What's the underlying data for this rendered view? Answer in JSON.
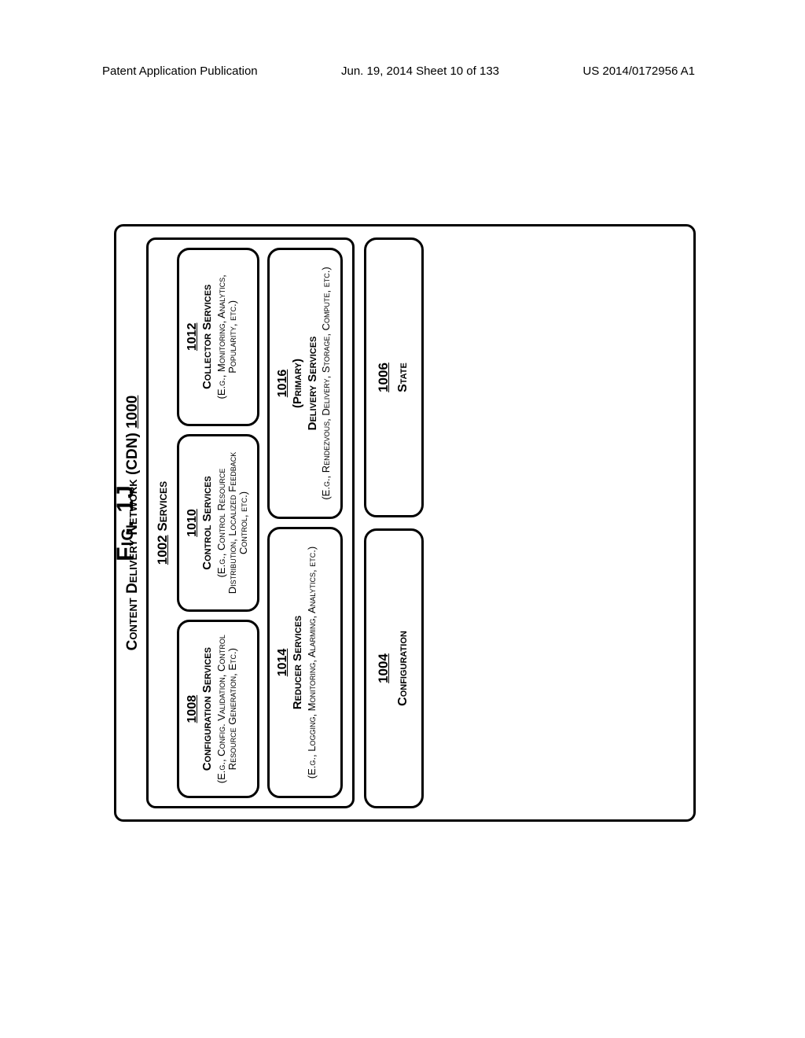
{
  "header": {
    "left": "Patent Application Publication",
    "mid": "Jun. 19, 2014  Sheet 10 of 133",
    "right": "US 2014/0172956 A1"
  },
  "outer": {
    "title_text": "Content Delivery Network (CDN)",
    "title_num": "1000"
  },
  "services": {
    "num": "1002",
    "label": "Services"
  },
  "svc": {
    "config": {
      "num": "1008",
      "name": "Configuration Services",
      "desc": "(E.g., Config. Validation, Control Resource Generation, Etc.)"
    },
    "control": {
      "num": "1010",
      "name": "Control Services",
      "desc": "(E.g., Control Resource Distribution, Localized Feedback Control, etc.)"
    },
    "collector": {
      "num": "1012",
      "name": "Collector Services",
      "desc": "(E.g., Monitoring, Analytics, Popularity, etc.)"
    },
    "reducer": {
      "num": "1014",
      "name": "Reducer Services",
      "desc": "(E.g., Logging, Monitoring, Alarming, Analytics, etc.)"
    },
    "delivery": {
      "num": "1016",
      "primary": "(Primary)",
      "name": "Delivery Services",
      "desc": "(E.g., Rendezvous, Delivery, Storage, Compute, etc.)"
    }
  },
  "bottom": {
    "config": {
      "num": "1004",
      "label": "Configuration"
    },
    "state": {
      "num": "1006",
      "label": "State"
    }
  },
  "figure_label": "Fig. 1J"
}
